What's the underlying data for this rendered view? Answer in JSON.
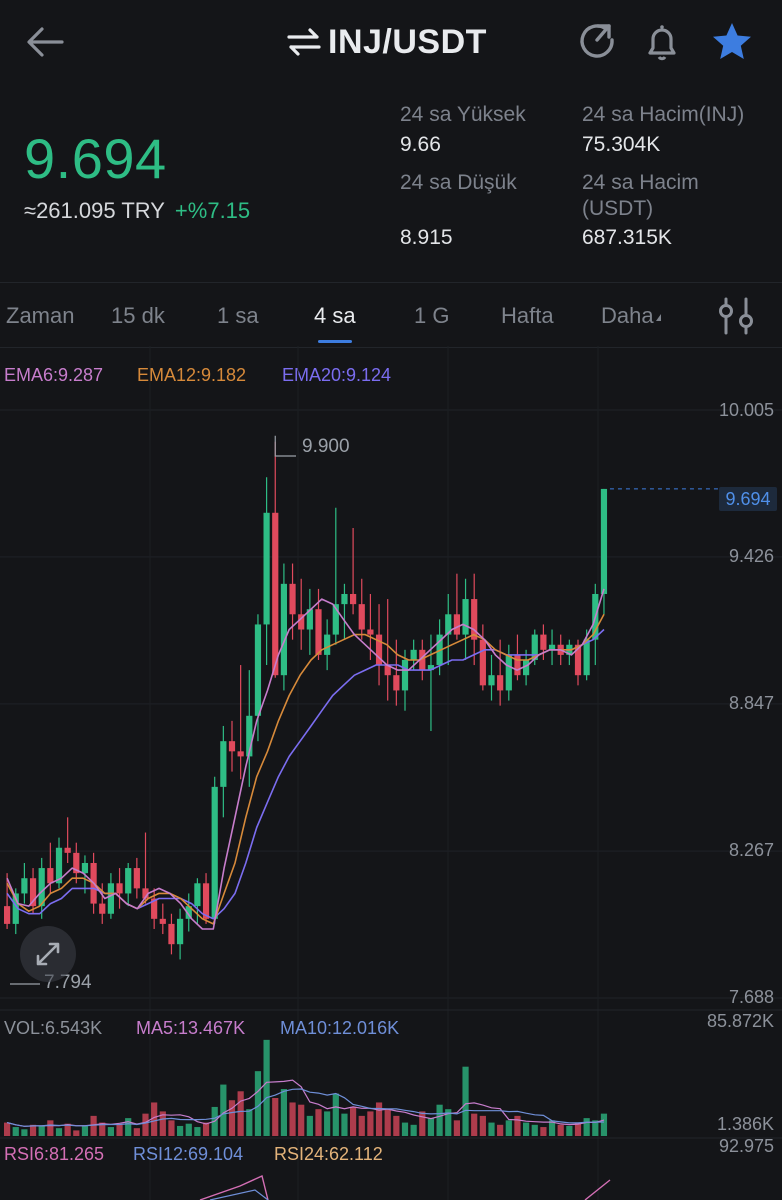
{
  "header": {
    "pair": "INJ/USDT",
    "icons": {
      "back": "arrow-left-icon",
      "swap": "swap-arrows-icon",
      "share": "share-refresh-icon",
      "alert": "bell-icon",
      "favorite": "star-icon"
    }
  },
  "ticker": {
    "last_price": "9.694",
    "try_value": "≈261.095 TRY",
    "change": "+%7.15",
    "high_label": "24 sa Yüksek",
    "high_value": "9.66",
    "low_label": "24 sa Düşük",
    "low_value": "8.915",
    "vol_base_label": "24 sa Hacim(INJ)",
    "vol_base_value": "75.304K",
    "vol_quote_label_1": "24 sa Hacim",
    "vol_quote_label_2": "(USDT)",
    "vol_quote_value": "687.315K"
  },
  "intervals": {
    "items": [
      "Zaman",
      "15 dk",
      "1 sa",
      "4 sa",
      "1 G",
      "Hafta",
      "Daha"
    ],
    "active": "4 sa",
    "settings_icon": "indicator-settings-icon"
  },
  "colors": {
    "up": "#2ebd85",
    "down": "#e04a5d",
    "ema6": "#c77dcc",
    "ema12": "#d78a3a",
    "ema20": "#7b6df0",
    "ma5": "#c77dcc",
    "ma10": "#6f8fd8",
    "rsi6": "#d46fb5",
    "rsi12": "#6f8fd8",
    "rsi24": "#e3b37a",
    "accent": "#3d7de0"
  },
  "legends": {
    "ema6": "EMA6:9.287",
    "ema12": "EMA12:9.182",
    "ema20": "EMA20:9.124",
    "vol": "VOL:6.543K",
    "ma5": "MA5:13.467K",
    "ma10": "MA10:12.016K",
    "rsi6": "RSI6:81.265",
    "rsi12": "RSI12:69.104",
    "rsi24": "RSI24:62.112"
  },
  "axes": {
    "price_ticks": [
      "10.005",
      "9.426",
      "8.847",
      "8.267",
      "7.688"
    ],
    "current_price_tag": "9.694",
    "high_marker": "9.900",
    "low_marker": "7.794",
    "vol_max": "85.872K",
    "vol_min": "1.386K",
    "rsi_max": "92.975"
  },
  "chart_data": {
    "type": "candlestick",
    "y_range": [
      7.688,
      10.005
    ],
    "candles": [
      [
        8.05,
        8.18,
        7.96,
        7.98
      ],
      [
        7.98,
        8.12,
        7.94,
        8.1
      ],
      [
        8.1,
        8.22,
        8.06,
        8.16
      ],
      [
        8.16,
        8.2,
        8.02,
        8.05
      ],
      [
        8.05,
        8.24,
        8.0,
        8.2
      ],
      [
        8.2,
        8.3,
        8.1,
        8.14
      ],
      [
        8.14,
        8.32,
        8.12,
        8.28
      ],
      [
        8.28,
        8.4,
        8.22,
        8.26
      ],
      [
        8.26,
        8.3,
        8.14,
        8.18
      ],
      [
        8.18,
        8.25,
        8.1,
        8.22
      ],
      [
        8.22,
        8.26,
        8.02,
        8.06
      ],
      [
        8.06,
        8.14,
        7.98,
        8.02
      ],
      [
        8.02,
        8.18,
        8.0,
        8.14
      ],
      [
        8.14,
        8.2,
        8.04,
        8.1
      ],
      [
        8.1,
        8.22,
        8.05,
        8.2
      ],
      [
        8.2,
        8.24,
        8.08,
        8.12
      ],
      [
        8.12,
        8.34,
        8.06,
        8.08
      ],
      [
        8.08,
        8.12,
        7.96,
        8.0
      ],
      [
        8.0,
        8.06,
        7.94,
        7.98
      ],
      [
        7.98,
        8.02,
        7.86,
        7.9
      ],
      [
        7.9,
        8.04,
        7.84,
        8.0
      ],
      [
        8.0,
        8.1,
        7.95,
        8.05
      ],
      [
        8.05,
        8.16,
        7.98,
        8.14
      ],
      [
        8.14,
        8.18,
        7.98,
        8.0
      ],
      [
        8.0,
        8.56,
        7.98,
        8.52
      ],
      [
        8.52,
        8.76,
        8.4,
        8.7
      ],
      [
        8.7,
        8.78,
        8.58,
        8.66
      ],
      [
        8.66,
        9.0,
        8.55,
        8.64
      ],
      [
        8.64,
        8.98,
        8.52,
        8.8
      ],
      [
        8.8,
        9.2,
        8.7,
        9.16
      ],
      [
        9.16,
        9.74,
        9.0,
        9.6
      ],
      [
        9.6,
        9.88,
        8.95,
        8.96
      ],
      [
        8.96,
        9.4,
        8.9,
        9.32
      ],
      [
        9.32,
        9.4,
        9.1,
        9.2
      ],
      [
        9.2,
        9.34,
        9.06,
        9.14
      ],
      [
        9.14,
        9.3,
        9.04,
        9.22
      ],
      [
        9.22,
        9.3,
        9.02,
        9.04
      ],
      [
        9.04,
        9.18,
        8.98,
        9.12
      ],
      [
        9.12,
        9.62,
        9.08,
        9.24
      ],
      [
        9.24,
        9.32,
        9.1,
        9.28
      ],
      [
        9.28,
        9.54,
        9.2,
        9.24
      ],
      [
        9.24,
        9.34,
        9.1,
        9.14
      ],
      [
        9.14,
        9.28,
        9.02,
        9.12
      ],
      [
        9.12,
        9.24,
        8.92,
        9.0
      ],
      [
        9.0,
        9.26,
        8.86,
        8.96
      ],
      [
        8.96,
        9.1,
        8.84,
        8.9
      ],
      [
        8.9,
        9.06,
        8.82,
        9.02
      ],
      [
        9.02,
        9.1,
        8.98,
        9.06
      ],
      [
        9.06,
        9.1,
        8.94,
        8.98
      ],
      [
        8.98,
        9.12,
        8.74,
        9.0
      ],
      [
        9.0,
        9.18,
        8.96,
        9.12
      ],
      [
        9.12,
        9.28,
        9.0,
        9.2
      ],
      [
        9.2,
        9.36,
        9.1,
        9.12
      ],
      [
        9.12,
        9.34,
        9.02,
        9.26
      ],
      [
        9.26,
        9.36,
        9.0,
        9.1
      ],
      [
        9.1,
        9.16,
        8.9,
        8.92
      ],
      [
        8.92,
        9.04,
        8.86,
        8.96
      ],
      [
        8.96,
        9.1,
        8.84,
        8.9
      ],
      [
        8.9,
        9.08,
        8.86,
        9.04
      ],
      [
        9.04,
        9.12,
        8.94,
        8.96
      ],
      [
        8.96,
        9.06,
        8.92,
        9.02
      ],
      [
        9.02,
        9.14,
        9.0,
        9.12
      ],
      [
        9.12,
        9.16,
        9.02,
        9.06
      ],
      [
        9.06,
        9.14,
        9.0,
        9.08
      ],
      [
        9.08,
        9.12,
        9.0,
        9.04
      ],
      [
        9.04,
        9.1,
        9.0,
        9.08
      ],
      [
        9.08,
        9.1,
        8.92,
        8.96
      ],
      [
        8.96,
        9.14,
        8.94,
        9.1
      ],
      [
        9.1,
        9.32,
        9.0,
        9.28
      ],
      [
        9.28,
        9.694,
        9.2,
        9.694
      ]
    ],
    "ema20_values": [
      8.1,
      8.04,
      8.02,
      8.02,
      8.06,
      8.08,
      8.12,
      8.12,
      8.12,
      8.1,
      8.1,
      8.06,
      8.04,
      8.06,
      8.08,
      8.08,
      8.08,
      8.06,
      8.02,
      8.0,
      8.04,
      8.1,
      8.22,
      8.36,
      8.46,
      8.56,
      8.64,
      8.7,
      8.76,
      8.82,
      8.88,
      8.92,
      8.96,
      8.98,
      9.0,
      9.0,
      9.0,
      8.98,
      8.98,
      8.98,
      9.0,
      9.02,
      9.02,
      9.04,
      9.06,
      9.06,
      9.04,
      9.04,
      9.04,
      9.04,
      9.06,
      9.06,
      9.06,
      9.08,
      9.1,
      9.14
    ],
    "ema12_values": [
      8.14,
      8.06,
      8.03,
      8.05,
      8.1,
      8.12,
      8.16,
      8.16,
      8.14,
      8.1,
      8.1,
      8.06,
      8.04,
      8.08,
      8.1,
      8.1,
      8.08,
      8.04,
      8.0,
      7.98,
      8.1,
      8.22,
      8.4,
      8.56,
      8.66,
      8.78,
      8.88,
      8.96,
      9.02,
      9.06,
      9.08,
      9.1,
      9.12,
      9.12,
      9.1,
      9.08,
      9.04,
      9.02,
      9.02,
      9.04,
      9.06,
      9.08,
      9.1,
      9.12,
      9.1,
      9.06,
      9.04,
      9.02,
      9.02,
      9.04,
      9.06,
      9.06,
      9.06,
      9.08,
      9.12,
      9.2
    ],
    "ema6_values": [
      8.16,
      8.06,
      8.05,
      8.1,
      8.14,
      8.16,
      8.2,
      8.18,
      8.14,
      8.08,
      8.1,
      8.06,
      8.04,
      8.1,
      8.12,
      8.1,
      8.06,
      8.0,
      7.96,
      7.96,
      8.2,
      8.4,
      8.6,
      8.78,
      8.9,
      9.04,
      9.14,
      9.18,
      9.22,
      9.26,
      9.24,
      9.18,
      9.12,
      9.08,
      9.04,
      9.0,
      8.98,
      8.98,
      9.02,
      9.06,
      9.1,
      9.14,
      9.16,
      9.14,
      9.1,
      9.04,
      9.0,
      8.98,
      9.0,
      9.04,
      9.06,
      9.06,
      9.04,
      9.08,
      9.16,
      9.3
    ],
    "volume": [
      12,
      8,
      6,
      10,
      9,
      14,
      7,
      11,
      5,
      9,
      18,
      12,
      8,
      10,
      16,
      7,
      20,
      30,
      22,
      14,
      9,
      11,
      8,
      12,
      26,
      46,
      32,
      40,
      24,
      58,
      86,
      34,
      42,
      30,
      28,
      18,
      24,
      22,
      38,
      20,
      26,
      18,
      22,
      30,
      24,
      18,
      12,
      10,
      22,
      16,
      28,
      24,
      14,
      62,
      20,
      18,
      12,
      10,
      14,
      18,
      12,
      10,
      8,
      14,
      10,
      9,
      12,
      16,
      14,
      20
    ],
    "volume_unit": "K"
  }
}
